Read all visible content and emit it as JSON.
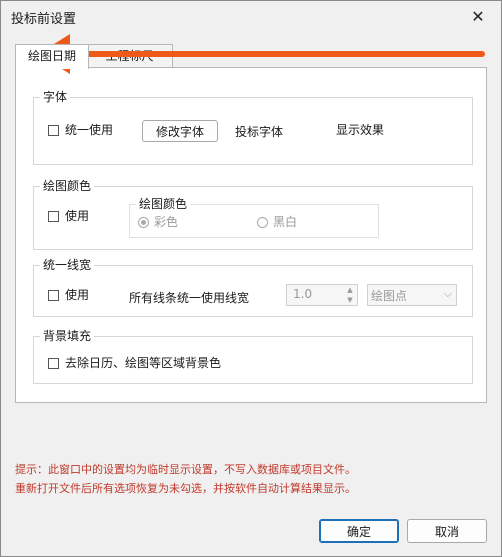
{
  "window": {
    "title": "投标前设置",
    "close_glyph": "✕"
  },
  "tabs": [
    {
      "label": "绘图日期"
    },
    {
      "label": "工程标尺"
    }
  ],
  "font_group": {
    "title": "字体",
    "unify_label": "统一使用",
    "modify_button": "修改字体",
    "bid_font_label": "投标字体",
    "preview_text": "显示效果"
  },
  "color_group": {
    "title": "绘图颜色",
    "use_label": "使用",
    "inner_title": "绘图颜色",
    "option_color": "彩色",
    "option_bw": "黑白"
  },
  "linewidth_group": {
    "title": "统一线宽",
    "use_label": "使用",
    "all_lines_label": "所有线条统一使用线宽",
    "width_value": "1.0",
    "unit_value": "绘图点"
  },
  "background_group": {
    "title": "背景填充",
    "remove_label": "去除日历、绘图等区域背景色"
  },
  "notice": {
    "line1": "提示：此窗口中的设置均为临时显示设置，不写入数据库或项目文件。",
    "line2": "重新打开文件后所有选项恢复为未勾选，并按软件自动计算结果显示。"
  },
  "buttons": {
    "ok": "确定",
    "cancel": "取消"
  },
  "colors": {
    "annotation_arrow": "#f05a19",
    "notice_text": "#c0392b",
    "accent": "#1d6fb8"
  }
}
